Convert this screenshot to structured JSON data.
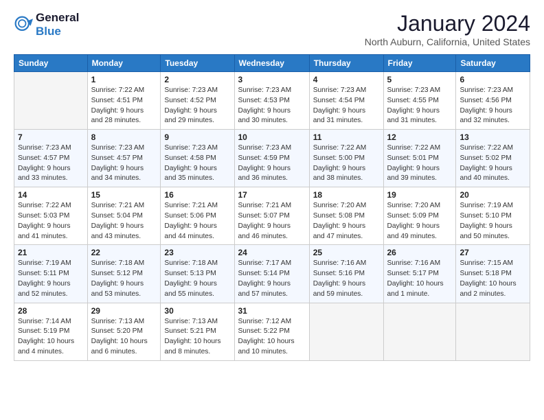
{
  "header": {
    "logo_line1": "General",
    "logo_line2": "Blue",
    "title": "January 2024",
    "location": "North Auburn, California, United States"
  },
  "days_of_week": [
    "Sunday",
    "Monday",
    "Tuesday",
    "Wednesday",
    "Thursday",
    "Friday",
    "Saturday"
  ],
  "weeks": [
    [
      {
        "day": "",
        "empty": true
      },
      {
        "day": "1",
        "sunrise": "7:22 AM",
        "sunset": "4:51 PM",
        "daylight": "9 hours and 28 minutes."
      },
      {
        "day": "2",
        "sunrise": "7:23 AM",
        "sunset": "4:52 PM",
        "daylight": "9 hours and 29 minutes."
      },
      {
        "day": "3",
        "sunrise": "7:23 AM",
        "sunset": "4:53 PM",
        "daylight": "9 hours and 30 minutes."
      },
      {
        "day": "4",
        "sunrise": "7:23 AM",
        "sunset": "4:54 PM",
        "daylight": "9 hours and 31 minutes."
      },
      {
        "day": "5",
        "sunrise": "7:23 AM",
        "sunset": "4:55 PM",
        "daylight": "9 hours and 31 minutes."
      },
      {
        "day": "6",
        "sunrise": "7:23 AM",
        "sunset": "4:56 PM",
        "daylight": "9 hours and 32 minutes."
      }
    ],
    [
      {
        "day": "7",
        "sunrise": "7:23 AM",
        "sunset": "4:57 PM",
        "daylight": "9 hours and 33 minutes."
      },
      {
        "day": "8",
        "sunrise": "7:23 AM",
        "sunset": "4:57 PM",
        "daylight": "9 hours and 34 minutes."
      },
      {
        "day": "9",
        "sunrise": "7:23 AM",
        "sunset": "4:58 PM",
        "daylight": "9 hours and 35 minutes."
      },
      {
        "day": "10",
        "sunrise": "7:23 AM",
        "sunset": "4:59 PM",
        "daylight": "9 hours and 36 minutes."
      },
      {
        "day": "11",
        "sunrise": "7:22 AM",
        "sunset": "5:00 PM",
        "daylight": "9 hours and 38 minutes."
      },
      {
        "day": "12",
        "sunrise": "7:22 AM",
        "sunset": "5:01 PM",
        "daylight": "9 hours and 39 minutes."
      },
      {
        "day": "13",
        "sunrise": "7:22 AM",
        "sunset": "5:02 PM",
        "daylight": "9 hours and 40 minutes."
      }
    ],
    [
      {
        "day": "14",
        "sunrise": "7:22 AM",
        "sunset": "5:03 PM",
        "daylight": "9 hours and 41 minutes."
      },
      {
        "day": "15",
        "sunrise": "7:21 AM",
        "sunset": "5:04 PM",
        "daylight": "9 hours and 43 minutes."
      },
      {
        "day": "16",
        "sunrise": "7:21 AM",
        "sunset": "5:06 PM",
        "daylight": "9 hours and 44 minutes."
      },
      {
        "day": "17",
        "sunrise": "7:21 AM",
        "sunset": "5:07 PM",
        "daylight": "9 hours and 46 minutes."
      },
      {
        "day": "18",
        "sunrise": "7:20 AM",
        "sunset": "5:08 PM",
        "daylight": "9 hours and 47 minutes."
      },
      {
        "day": "19",
        "sunrise": "7:20 AM",
        "sunset": "5:09 PM",
        "daylight": "9 hours and 49 minutes."
      },
      {
        "day": "20",
        "sunrise": "7:19 AM",
        "sunset": "5:10 PM",
        "daylight": "9 hours and 50 minutes."
      }
    ],
    [
      {
        "day": "21",
        "sunrise": "7:19 AM",
        "sunset": "5:11 PM",
        "daylight": "9 hours and 52 minutes."
      },
      {
        "day": "22",
        "sunrise": "7:18 AM",
        "sunset": "5:12 PM",
        "daylight": "9 hours and 53 minutes."
      },
      {
        "day": "23",
        "sunrise": "7:18 AM",
        "sunset": "5:13 PM",
        "daylight": "9 hours and 55 minutes."
      },
      {
        "day": "24",
        "sunrise": "7:17 AM",
        "sunset": "5:14 PM",
        "daylight": "9 hours and 57 minutes."
      },
      {
        "day": "25",
        "sunrise": "7:16 AM",
        "sunset": "5:16 PM",
        "daylight": "9 hours and 59 minutes."
      },
      {
        "day": "26",
        "sunrise": "7:16 AM",
        "sunset": "5:17 PM",
        "daylight": "10 hours and 1 minute."
      },
      {
        "day": "27",
        "sunrise": "7:15 AM",
        "sunset": "5:18 PM",
        "daylight": "10 hours and 2 minutes."
      }
    ],
    [
      {
        "day": "28",
        "sunrise": "7:14 AM",
        "sunset": "5:19 PM",
        "daylight": "10 hours and 4 minutes."
      },
      {
        "day": "29",
        "sunrise": "7:13 AM",
        "sunset": "5:20 PM",
        "daylight": "10 hours and 6 minutes."
      },
      {
        "day": "30",
        "sunrise": "7:13 AM",
        "sunset": "5:21 PM",
        "daylight": "10 hours and 8 minutes."
      },
      {
        "day": "31",
        "sunrise": "7:12 AM",
        "sunset": "5:22 PM",
        "daylight": "10 hours and 10 minutes."
      },
      {
        "day": "",
        "empty": true
      },
      {
        "day": "",
        "empty": true
      },
      {
        "day": "",
        "empty": true
      }
    ]
  ],
  "labels": {
    "sunrise": "Sunrise:",
    "sunset": "Sunset:",
    "daylight": "Daylight:"
  }
}
